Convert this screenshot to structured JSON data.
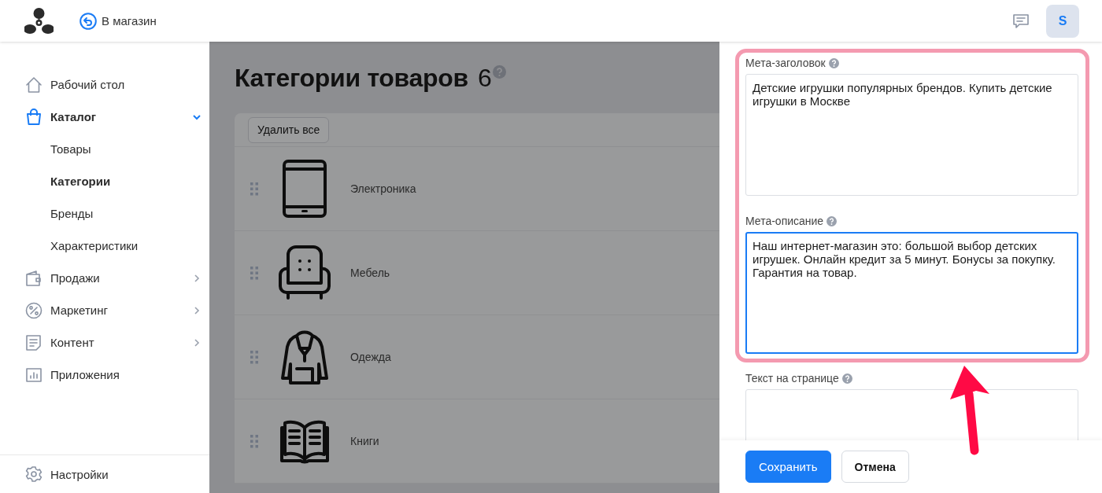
{
  "header": {
    "back_link": "В магазин",
    "avatar": "S"
  },
  "sidebar": {
    "items": [
      {
        "label": "Рабочий стол",
        "selected": false,
        "has_submenu": false
      },
      {
        "label": "Каталог",
        "selected": true,
        "has_submenu": true,
        "expanded": true,
        "children": [
          {
            "label": "Товары",
            "selected": false
          },
          {
            "label": "Категории",
            "selected": true
          },
          {
            "label": "Бренды",
            "selected": false
          },
          {
            "label": "Характеристики",
            "selected": false
          }
        ]
      },
      {
        "label": "Продажи",
        "selected": false,
        "has_submenu": true,
        "expanded": false
      },
      {
        "label": "Маркетинг",
        "selected": false,
        "has_submenu": true,
        "expanded": false
      },
      {
        "label": "Контент",
        "selected": false,
        "has_submenu": true,
        "expanded": false
      },
      {
        "label": "Приложения",
        "selected": false,
        "has_submenu": false
      }
    ],
    "footer_item": {
      "label": "Настройки"
    }
  },
  "page": {
    "title": "Категории товаров",
    "count": "6",
    "toolbar_button": "Удалить все",
    "categories": [
      {
        "name": "Электроника"
      },
      {
        "name": "Мебель"
      },
      {
        "name": "Одежда"
      },
      {
        "name": "Книги"
      }
    ]
  },
  "panel": {
    "highlighted_fields": [
      {
        "label": "Мета-заголовок",
        "value": "Детские игрушки популярных брендов. Купить детские игрушки в Москве",
        "focused": false
      },
      {
        "label": "Мета-описание",
        "value": "Наш интернет-магазин это: большой выбор детских игрушек. Онлайн кредит за 5 минут. Бонусы за покупку. Гарантия на товар.",
        "focused": true
      }
    ],
    "fields": [
      {
        "label": "Текст на странице",
        "focused": false
      }
    ],
    "buttons": [
      {
        "label": "Сохранить",
        "kind": "primary"
      },
      {
        "label": "Отмена",
        "kind": "secondary"
      }
    ]
  }
}
